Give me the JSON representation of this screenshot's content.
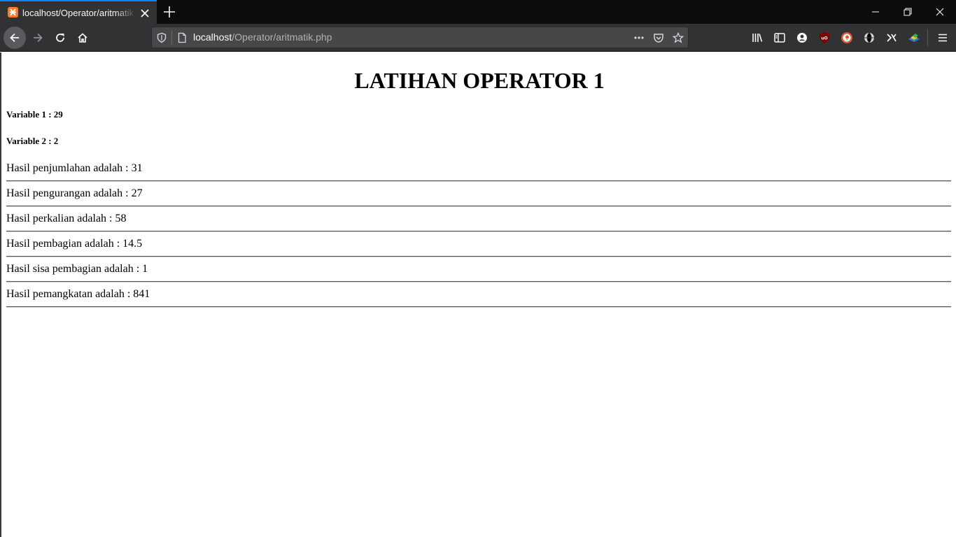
{
  "browser": {
    "tab_title": "localhost/Operator/aritmatik.php",
    "url_host": "localhost",
    "url_path": "/Operator/aritmatik.php"
  },
  "page": {
    "heading": "LATIHAN OPERATOR 1",
    "variables": [
      "Variable 1 : 29",
      "Variable 2 : 2"
    ],
    "results": [
      "Hasil penjumlahan adalah : 31",
      "Hasil pengurangan adalah : 27",
      "Hasil perkalian adalah : 58",
      "Hasil pembagian adalah : 14.5",
      "Hasil sisa pembagian adalah : 1",
      "Hasil pemangkatan adalah : 841"
    ]
  },
  "icons": {
    "favicon": "xampp-icon",
    "close": "close-icon",
    "new_tab": "plus-icon",
    "back": "arrow-left-icon",
    "forward": "arrow-right-icon",
    "reload": "reload-icon",
    "home": "home-icon",
    "shield": "shield-icon",
    "page": "page-icon",
    "more": "more-dots-icon",
    "pocket": "pocket-icon",
    "bookmark": "star-icon",
    "library": "library-icon",
    "sidebar": "sidebar-icon",
    "account": "account-icon",
    "ublock": "ublock-icon",
    "duckduckgo": "duckduckgo-icon",
    "globe": "globe-icon",
    "extension": "extension-icon",
    "colorful": "color-extension-icon",
    "menu": "hamburger-menu-icon"
  },
  "colors": {
    "tab_accent": "#0a84ff",
    "chrome_dark": "#0c0c0d",
    "toolbar": "#323234",
    "urlbar": "#474749",
    "favicon": "#fb7a24"
  }
}
